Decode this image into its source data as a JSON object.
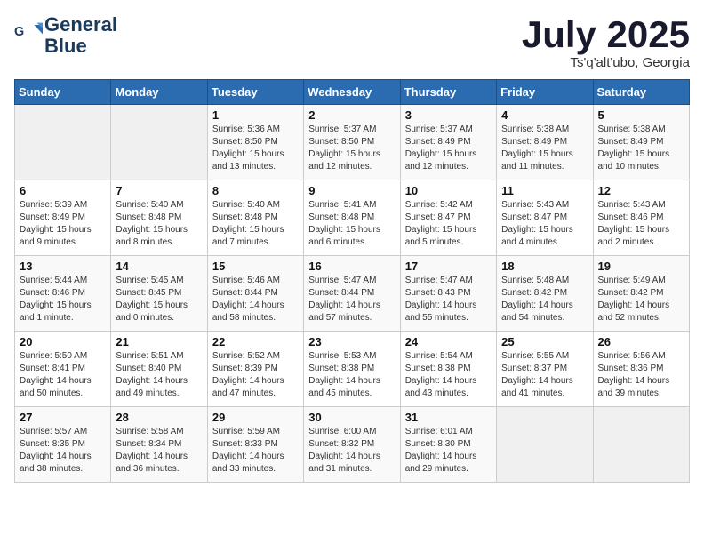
{
  "logo": {
    "line1": "General",
    "line2": "Blue"
  },
  "title": "July 2025",
  "location": "Ts'q'alt'ubo, Georgia",
  "days_header": [
    "Sunday",
    "Monday",
    "Tuesday",
    "Wednesday",
    "Thursday",
    "Friday",
    "Saturday"
  ],
  "weeks": [
    [
      {
        "day": "",
        "info": ""
      },
      {
        "day": "",
        "info": ""
      },
      {
        "day": "1",
        "info": "Sunrise: 5:36 AM\nSunset: 8:50 PM\nDaylight: 15 hours\nand 13 minutes."
      },
      {
        "day": "2",
        "info": "Sunrise: 5:37 AM\nSunset: 8:50 PM\nDaylight: 15 hours\nand 12 minutes."
      },
      {
        "day": "3",
        "info": "Sunrise: 5:37 AM\nSunset: 8:49 PM\nDaylight: 15 hours\nand 12 minutes."
      },
      {
        "day": "4",
        "info": "Sunrise: 5:38 AM\nSunset: 8:49 PM\nDaylight: 15 hours\nand 11 minutes."
      },
      {
        "day": "5",
        "info": "Sunrise: 5:38 AM\nSunset: 8:49 PM\nDaylight: 15 hours\nand 10 minutes."
      }
    ],
    [
      {
        "day": "6",
        "info": "Sunrise: 5:39 AM\nSunset: 8:49 PM\nDaylight: 15 hours\nand 9 minutes."
      },
      {
        "day": "7",
        "info": "Sunrise: 5:40 AM\nSunset: 8:48 PM\nDaylight: 15 hours\nand 8 minutes."
      },
      {
        "day": "8",
        "info": "Sunrise: 5:40 AM\nSunset: 8:48 PM\nDaylight: 15 hours\nand 7 minutes."
      },
      {
        "day": "9",
        "info": "Sunrise: 5:41 AM\nSunset: 8:48 PM\nDaylight: 15 hours\nand 6 minutes."
      },
      {
        "day": "10",
        "info": "Sunrise: 5:42 AM\nSunset: 8:47 PM\nDaylight: 15 hours\nand 5 minutes."
      },
      {
        "day": "11",
        "info": "Sunrise: 5:43 AM\nSunset: 8:47 PM\nDaylight: 15 hours\nand 4 minutes."
      },
      {
        "day": "12",
        "info": "Sunrise: 5:43 AM\nSunset: 8:46 PM\nDaylight: 15 hours\nand 2 minutes."
      }
    ],
    [
      {
        "day": "13",
        "info": "Sunrise: 5:44 AM\nSunset: 8:46 PM\nDaylight: 15 hours\nand 1 minute."
      },
      {
        "day": "14",
        "info": "Sunrise: 5:45 AM\nSunset: 8:45 PM\nDaylight: 15 hours\nand 0 minutes."
      },
      {
        "day": "15",
        "info": "Sunrise: 5:46 AM\nSunset: 8:44 PM\nDaylight: 14 hours\nand 58 minutes."
      },
      {
        "day": "16",
        "info": "Sunrise: 5:47 AM\nSunset: 8:44 PM\nDaylight: 14 hours\nand 57 minutes."
      },
      {
        "day": "17",
        "info": "Sunrise: 5:47 AM\nSunset: 8:43 PM\nDaylight: 14 hours\nand 55 minutes."
      },
      {
        "day": "18",
        "info": "Sunrise: 5:48 AM\nSunset: 8:42 PM\nDaylight: 14 hours\nand 54 minutes."
      },
      {
        "day": "19",
        "info": "Sunrise: 5:49 AM\nSunset: 8:42 PM\nDaylight: 14 hours\nand 52 minutes."
      }
    ],
    [
      {
        "day": "20",
        "info": "Sunrise: 5:50 AM\nSunset: 8:41 PM\nDaylight: 14 hours\nand 50 minutes."
      },
      {
        "day": "21",
        "info": "Sunrise: 5:51 AM\nSunset: 8:40 PM\nDaylight: 14 hours\nand 49 minutes."
      },
      {
        "day": "22",
        "info": "Sunrise: 5:52 AM\nSunset: 8:39 PM\nDaylight: 14 hours\nand 47 minutes."
      },
      {
        "day": "23",
        "info": "Sunrise: 5:53 AM\nSunset: 8:38 PM\nDaylight: 14 hours\nand 45 minutes."
      },
      {
        "day": "24",
        "info": "Sunrise: 5:54 AM\nSunset: 8:38 PM\nDaylight: 14 hours\nand 43 minutes."
      },
      {
        "day": "25",
        "info": "Sunrise: 5:55 AM\nSunset: 8:37 PM\nDaylight: 14 hours\nand 41 minutes."
      },
      {
        "day": "26",
        "info": "Sunrise: 5:56 AM\nSunset: 8:36 PM\nDaylight: 14 hours\nand 39 minutes."
      }
    ],
    [
      {
        "day": "27",
        "info": "Sunrise: 5:57 AM\nSunset: 8:35 PM\nDaylight: 14 hours\nand 38 minutes."
      },
      {
        "day": "28",
        "info": "Sunrise: 5:58 AM\nSunset: 8:34 PM\nDaylight: 14 hours\nand 36 minutes."
      },
      {
        "day": "29",
        "info": "Sunrise: 5:59 AM\nSunset: 8:33 PM\nDaylight: 14 hours\nand 33 minutes."
      },
      {
        "day": "30",
        "info": "Sunrise: 6:00 AM\nSunset: 8:32 PM\nDaylight: 14 hours\nand 31 minutes."
      },
      {
        "day": "31",
        "info": "Sunrise: 6:01 AM\nSunset: 8:30 PM\nDaylight: 14 hours\nand 29 minutes."
      },
      {
        "day": "",
        "info": ""
      },
      {
        "day": "",
        "info": ""
      }
    ]
  ]
}
